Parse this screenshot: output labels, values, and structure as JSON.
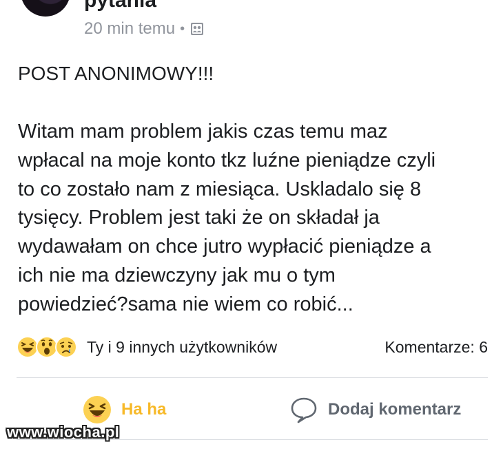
{
  "post": {
    "author": "pytania",
    "timestamp": "20 min temu",
    "meta_separator": "•",
    "privacy_icon": "group-icon",
    "title": "POST ANONIMOWY!!!",
    "body_lines": [
      "Witam mam problem jakis czas temu maz",
      "wpłacal na moje konto tkz luźne pieniądze czyli",
      "to co zostało nam z miesiąca. Uskladalo się 8",
      "tysięcy. Problem jest taki że on składał ja",
      "wydawałam on chce jutro wypłacić pieniądze a",
      "ich nie ma dziewczyny jak mu o tym",
      "powiedzieć?sama nie wiem co robić..."
    ]
  },
  "reactions": {
    "icons": [
      "haha-reaction-icon",
      "wow-reaction-icon",
      "sad-reaction-icon"
    ],
    "summary": "Ty i 9 innych użytkowników",
    "comments": "Komentarze: 6"
  },
  "actions": {
    "haha_label": "Ha ha",
    "haha_color": "#f7b928",
    "comment_label": "Dodaj komentarz",
    "comment_color": "#606770"
  },
  "watermark": "www.wiocha.pl"
}
